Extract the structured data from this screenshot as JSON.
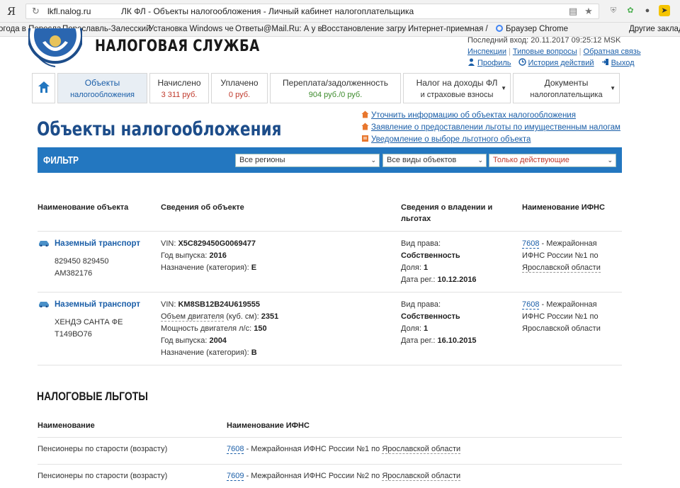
{
  "browser": {
    "logo": "Я",
    "url_host": "lkfl.nalog.ru",
    "tab_title": "ЛК ФЛ - Объекты налогообложения - Личный кабинет налогоплательщика",
    "bookmarks": [
      "огода в Пересла",
      "Переславль-Залесский",
      "Установка Windows че",
      "Ответы@Mail.Ru: А у в",
      "Восстановление загру",
      "Интернет-приемная /",
      "Браузер Chrome",
      "Другие заклад"
    ]
  },
  "header": {
    "service_name": "НАЛОГОВАЯ СЛУЖБА",
    "last_login": "Последний вход: 20.11.2017 09:25:12 MSK",
    "links": [
      "Инспекции",
      "Типовые вопросы",
      "Обратная связь"
    ],
    "profile": "Профиль",
    "history": "История действий",
    "logout": "Выход"
  },
  "tabs": [
    {
      "label": "Объекты",
      "sub": "налогообложения"
    },
    {
      "label": "Начислено",
      "sub": "3 311 руб."
    },
    {
      "label": "Уплачено",
      "sub": "0 руб."
    },
    {
      "label": "Переплата/задолженность",
      "sub": "904 руб./0 руб."
    },
    {
      "label": "Налог на доходы ФЛ",
      "sub": "и страховые взносы"
    },
    {
      "label": "Документы",
      "sub": "налогоплательщика"
    }
  ],
  "page": {
    "title": "Объекты налогообложения",
    "side_links": [
      "Уточнить информацию об объектах налогообложения",
      "Заявление о предоставлении льготы по имущественным налогам",
      "Уведомление о выборе льготного объекта"
    ]
  },
  "filter": {
    "label": "ФИЛЬТР",
    "region": "Все регионы",
    "object_type": "Все виды объектов",
    "status": "Только действующие"
  },
  "objects_table": {
    "headers": [
      "Наименование объекта",
      "Сведения об объекте",
      "Сведения о владении и льготах",
      "Наименование ИФНС"
    ],
    "rows": [
      {
        "name": "Наземный транспорт",
        "desc1": "829450 829450",
        "desc2": "АМ382176",
        "vin_label": "VIN:",
        "vin": "X5C829450G0069477",
        "year_label": "Год выпуска:",
        "year": "2016",
        "category_label": "Назначение (категория):",
        "category": "E",
        "right_label": "Вид права:",
        "right": "Собственность",
        "share_label": "Доля:",
        "share": "1",
        "reg_label": "Дата рег.:",
        "reg_date": "10.12.2016",
        "ifns_code": "7608",
        "ifns_name": " - Межрайонная",
        "ifns_name2": "ИФНС России №1 по",
        "ifns_name3": "Ярославской области"
      },
      {
        "name": "Наземный транспорт",
        "desc1": "ХЕНДЭ САНТА ФЕ",
        "desc2": "Т149ВО76",
        "vin_label": "VIN:",
        "vin": "KM8SB12B24U619555",
        "engine_vol_label": "Объем двигателя",
        "engine_vol_unit": " (куб. см):",
        "engine_vol": "2351",
        "power_label": "Мощность двигателя л/с:",
        "power": "150",
        "year_label": "Год выпуска:",
        "year": "2004",
        "category_label": "Назначение (категория):",
        "category": "B",
        "right_label": "Вид права:",
        "right": "Собственность",
        "share_label": "Доля:",
        "share": "1",
        "reg_label": "Дата рег.:",
        "reg_date": "16.10.2015",
        "ifns_code": "7608",
        "ifns_name": " - Межрайонная",
        "ifns_name2": "ИФНС России №1 по",
        "ifns_name3": "Ярославской области"
      }
    ]
  },
  "benefits": {
    "title": "НАЛОГОВЫЕ ЛЬГОТЫ",
    "headers": [
      "Наименование",
      "Наименование ИФНС"
    ],
    "rows": [
      {
        "name": "Пенсионеры по старости (возрасту)",
        "ifns_code": "7608",
        "ifns_name": " - Межрайонная ИФНС России №1 по ",
        "ifns_region": "Ярославской области"
      },
      {
        "name": "Пенсионеры по старости (возрасту)",
        "ifns_code": "7609",
        "ifns_name": " - Межрайонная ИФНС России №2 по ",
        "ifns_region": "Ярославской области"
      }
    ]
  }
}
